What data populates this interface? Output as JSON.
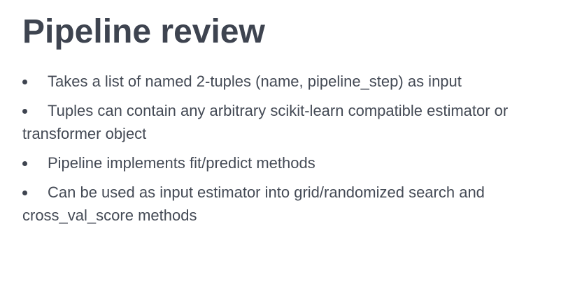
{
  "slide": {
    "title": "Pipeline review",
    "bullets": [
      "Takes a list of named 2-tuples (name, pipeline_step) as input",
      "Tuples can contain any arbitrary scikit-learn compatible estimator or transformer object",
      "Pipeline implements fit/predict methods",
      "Can be used as input estimator into grid/randomized search and cross_val_score methods"
    ]
  },
  "colors": {
    "text": "#444a55",
    "title": "#3e4450",
    "background": "#ffffff"
  }
}
